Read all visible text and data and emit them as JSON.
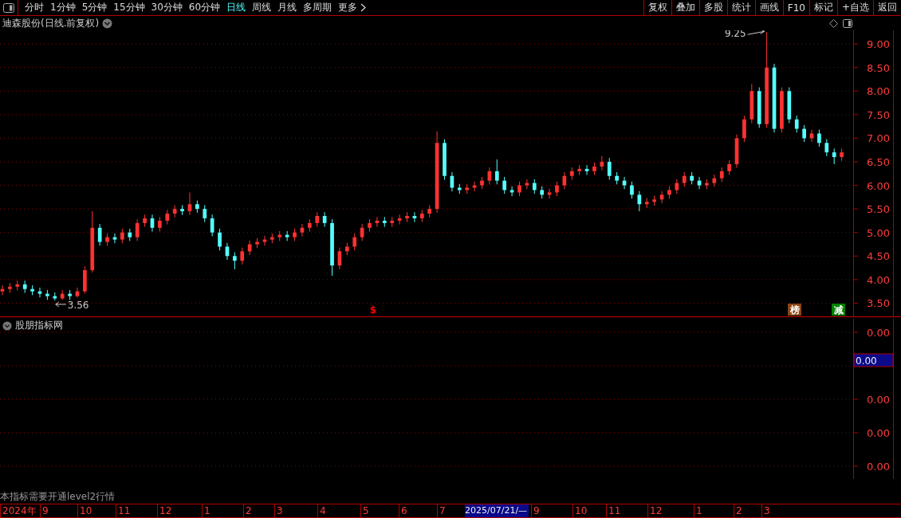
{
  "toolbar": {
    "periods": [
      {
        "label": "分时",
        "selected": false
      },
      {
        "label": "1分钟",
        "selected": false
      },
      {
        "label": "5分钟",
        "selected": false
      },
      {
        "label": "15分钟",
        "selected": false
      },
      {
        "label": "30分钟",
        "selected": false
      },
      {
        "label": "60分钟",
        "selected": false
      },
      {
        "label": "日线",
        "selected": true
      },
      {
        "label": "周线",
        "selected": false
      },
      {
        "label": "月线",
        "selected": false
      },
      {
        "label": "多周期",
        "selected": false
      },
      {
        "label": "更多",
        "selected": false
      }
    ],
    "buttons": [
      "复权",
      "叠加",
      "多股",
      "统计",
      "画线",
      "F10",
      "标记",
      "+自选",
      "返回"
    ]
  },
  "main_panel": {
    "title": "迪森股份(日线.前复权)",
    "chart_data": {
      "type": "candlestick",
      "ylim": [
        3.22,
        9.29
      ],
      "grid": true,
      "yticks": [
        {
          "value": 9.0,
          "label": "9.00"
        },
        {
          "value": 8.5,
          "label": "8.50"
        },
        {
          "value": 8.0,
          "label": "8.00"
        },
        {
          "value": 7.5,
          "label": "7.50"
        },
        {
          "value": 7.0,
          "label": "7.00"
        },
        {
          "value": 6.5,
          "label": "6.50"
        },
        {
          "value": 6.0,
          "label": "6.00"
        },
        {
          "value": 5.5,
          "label": "5.50"
        },
        {
          "value": 5.0,
          "label": "5.00"
        },
        {
          "value": 4.5,
          "label": "4.50"
        },
        {
          "value": 4.0,
          "label": "4.00"
        },
        {
          "value": 3.5,
          "label": "3.50"
        }
      ],
      "ohlc": [
        [
          3.75,
          3.88,
          3.67,
          3.8
        ],
        [
          3.8,
          3.93,
          3.72,
          3.85
        ],
        [
          3.85,
          3.98,
          3.77,
          3.9
        ],
        [
          3.9,
          3.98,
          3.72,
          3.8
        ],
        [
          3.8,
          3.88,
          3.67,
          3.75
        ],
        [
          3.75,
          3.83,
          3.62,
          3.7
        ],
        [
          3.7,
          3.78,
          3.57,
          3.65
        ],
        [
          3.65,
          3.73,
          3.56,
          3.6
        ],
        [
          3.6,
          3.78,
          3.57,
          3.7
        ],
        [
          3.7,
          3.78,
          3.57,
          3.65
        ],
        [
          3.65,
          3.83,
          3.62,
          3.75
        ],
        [
          3.75,
          4.28,
          3.7,
          4.2
        ],
        [
          4.2,
          5.45,
          4.15,
          5.1
        ],
        [
          5.1,
          5.18,
          4.72,
          4.8
        ],
        [
          4.8,
          4.98,
          4.72,
          4.9
        ],
        [
          4.9,
          4.98,
          4.77,
          4.85
        ],
        [
          4.85,
          5.08,
          4.77,
          5.0
        ],
        [
          5.0,
          5.08,
          4.82,
          4.9
        ],
        [
          4.9,
          5.28,
          4.82,
          5.2
        ],
        [
          5.2,
          5.38,
          5.12,
          5.3
        ],
        [
          5.3,
          5.38,
          5.02,
          5.1
        ],
        [
          5.1,
          5.33,
          5.02,
          5.25
        ],
        [
          5.25,
          5.48,
          5.17,
          5.4
        ],
        [
          5.4,
          5.58,
          5.32,
          5.5
        ],
        [
          5.5,
          5.58,
          5.37,
          5.45
        ],
        [
          5.45,
          5.85,
          5.37,
          5.6
        ],
        [
          5.6,
          5.68,
          5.42,
          5.5
        ],
        [
          5.5,
          5.58,
          5.22,
          5.3
        ],
        [
          5.3,
          5.38,
          4.92,
          5.0
        ],
        [
          5.0,
          5.08,
          4.62,
          4.7
        ],
        [
          4.7,
          4.78,
          4.42,
          4.5
        ],
        [
          4.5,
          4.58,
          4.22,
          4.4
        ],
        [
          4.4,
          4.68,
          4.32,
          4.6
        ],
        [
          4.6,
          4.83,
          4.52,
          4.75
        ],
        [
          4.75,
          4.88,
          4.67,
          4.8
        ],
        [
          4.8,
          4.93,
          4.72,
          4.85
        ],
        [
          4.85,
          4.98,
          4.77,
          4.9
        ],
        [
          4.9,
          5.03,
          4.82,
          4.95
        ],
        [
          4.95,
          5.03,
          4.82,
          4.9
        ],
        [
          4.9,
          5.08,
          4.82,
          5.0
        ],
        [
          5.0,
          5.18,
          4.92,
          5.1
        ],
        [
          5.1,
          5.28,
          5.02,
          5.2
        ],
        [
          5.2,
          5.43,
          5.12,
          5.35
        ],
        [
          5.35,
          5.43,
          5.12,
          5.2
        ],
        [
          5.2,
          5.28,
          4.08,
          4.3
        ],
        [
          4.3,
          4.68,
          4.22,
          4.6
        ],
        [
          4.6,
          4.78,
          4.52,
          4.7
        ],
        [
          4.7,
          4.98,
          4.62,
          4.9
        ],
        [
          4.9,
          5.18,
          4.82,
          5.1
        ],
        [
          5.1,
          5.28,
          5.02,
          5.2
        ],
        [
          5.2,
          5.33,
          5.12,
          5.25
        ],
        [
          5.25,
          5.33,
          5.12,
          5.2
        ],
        [
          5.2,
          5.33,
          5.12,
          5.25
        ],
        [
          5.25,
          5.38,
          5.17,
          5.3
        ],
        [
          5.3,
          5.43,
          5.22,
          5.35
        ],
        [
          5.35,
          5.43,
          5.22,
          5.3
        ],
        [
          5.3,
          5.48,
          5.22,
          5.4
        ],
        [
          5.4,
          5.58,
          5.32,
          5.5
        ],
        [
          5.5,
          7.15,
          5.42,
          6.9
        ],
        [
          6.9,
          6.98,
          6.12,
          6.2
        ],
        [
          6.2,
          6.28,
          5.87,
          5.95
        ],
        [
          5.95,
          6.03,
          5.82,
          5.9
        ],
        [
          5.9,
          6.03,
          5.82,
          5.95
        ],
        [
          5.95,
          6.08,
          5.87,
          6.0
        ],
        [
          6.0,
          6.18,
          5.92,
          6.1
        ],
        [
          6.1,
          6.38,
          6.02,
          6.3
        ],
        [
          6.3,
          6.55,
          6.02,
          6.1
        ],
        [
          6.1,
          6.18,
          5.82,
          5.9
        ],
        [
          5.9,
          5.98,
          5.77,
          5.85
        ],
        [
          5.85,
          6.08,
          5.77,
          6.0
        ],
        [
          6.0,
          6.13,
          5.92,
          6.05
        ],
        [
          6.05,
          6.13,
          5.82,
          5.9
        ],
        [
          5.9,
          5.98,
          5.72,
          5.8
        ],
        [
          5.8,
          5.93,
          5.72,
          5.85
        ],
        [
          5.85,
          6.08,
          5.77,
          6.0
        ],
        [
          6.0,
          6.28,
          5.92,
          6.2
        ],
        [
          6.2,
          6.38,
          6.12,
          6.3
        ],
        [
          6.3,
          6.43,
          6.22,
          6.35
        ],
        [
          6.35,
          6.43,
          6.22,
          6.3
        ],
        [
          6.3,
          6.48,
          6.22,
          6.4
        ],
        [
          6.4,
          6.62,
          6.32,
          6.5
        ],
        [
          6.5,
          6.58,
          6.12,
          6.2
        ],
        [
          6.2,
          6.28,
          6.02,
          6.1
        ],
        [
          6.1,
          6.18,
          5.92,
          6.0
        ],
        [
          6.0,
          6.08,
          5.72,
          5.8
        ],
        [
          5.8,
          5.88,
          5.45,
          5.6
        ],
        [
          5.6,
          5.73,
          5.52,
          5.65
        ],
        [
          5.65,
          5.78,
          5.57,
          5.7
        ],
        [
          5.7,
          5.88,
          5.62,
          5.8
        ],
        [
          5.8,
          5.98,
          5.72,
          5.9
        ],
        [
          5.9,
          6.13,
          5.82,
          6.05
        ],
        [
          6.05,
          6.28,
          5.97,
          6.2
        ],
        [
          6.2,
          6.28,
          6.02,
          6.1
        ],
        [
          6.1,
          6.18,
          5.92,
          6.0
        ],
        [
          6.0,
          6.13,
          5.92,
          6.05
        ],
        [
          6.05,
          6.23,
          5.97,
          6.15
        ],
        [
          6.15,
          6.38,
          6.07,
          6.3
        ],
        [
          6.3,
          6.53,
          6.22,
          6.45
        ],
        [
          6.45,
          7.08,
          6.37,
          7.0
        ],
        [
          7.0,
          7.48,
          6.92,
          7.4
        ],
        [
          7.4,
          8.15,
          7.32,
          8.0
        ],
        [
          8.0,
          8.08,
          7.22,
          7.3
        ],
        [
          7.3,
          9.25,
          7.22,
          8.5
        ],
        [
          8.5,
          8.58,
          7.12,
          7.2
        ],
        [
          7.2,
          8.08,
          7.12,
          8.0
        ],
        [
          8.0,
          8.08,
          7.32,
          7.4
        ],
        [
          7.4,
          7.48,
          7.12,
          7.2
        ],
        [
          7.2,
          7.28,
          6.92,
          7.0
        ],
        [
          7.0,
          7.18,
          6.92,
          7.1
        ],
        [
          7.1,
          7.18,
          6.82,
          6.9
        ],
        [
          6.9,
          6.98,
          6.62,
          6.7
        ],
        [
          6.7,
          6.78,
          6.45,
          6.6
        ],
        [
          6.6,
          6.78,
          6.52,
          6.7
        ]
      ],
      "annotations": [
        {
          "text": "9.25"
        },
        {
          "text": "3.56"
        }
      ]
    },
    "events": [
      {
        "text": "$",
        "color": "#ff0000"
      },
      {
        "text": "榜",
        "color": "#8b4513"
      },
      {
        "text": "减",
        "color": "#008000"
      }
    ]
  },
  "sub_panel": {
    "title": "股朋指标网",
    "ticks": [
      {
        "label": "0.00"
      },
      {
        "label": "0.00"
      },
      {
        "label": "0.00"
      },
      {
        "label": "0.00"
      }
    ],
    "cursor_value": "0.00"
  },
  "notice": "本指标需要开通level2行情",
  "time_axis": {
    "labels": [
      "2024年",
      "9",
      "10",
      "11",
      "12",
      "1",
      "2",
      "3",
      "4",
      "5",
      "6",
      "7",
      "9",
      "10",
      "11",
      "12",
      "1",
      "2",
      "3"
    ],
    "cursor": "2025/07/21/—"
  }
}
